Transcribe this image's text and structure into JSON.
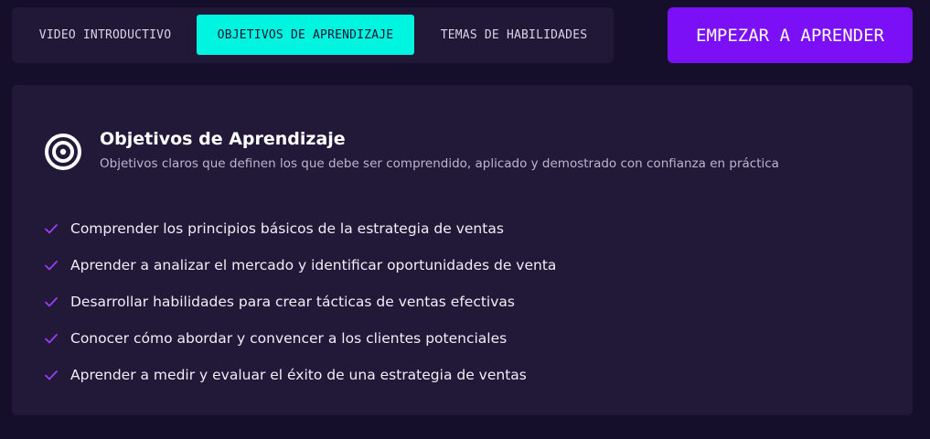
{
  "tabs": [
    {
      "label": "VIDEO INTRODUCTIVO",
      "active": false
    },
    {
      "label": "OBJETIVOS DE APRENDIZAJE",
      "active": true
    },
    {
      "label": "TEMAS DE HABILIDADES",
      "active": false
    }
  ],
  "cta": {
    "label": "EMPEZAR A APRENDER"
  },
  "panel": {
    "icon": "target-icon",
    "title": "Objetivos de Aprendizaje",
    "subtitle": "Objetivos claros que definen los que debe ser comprendido, aplicado y demostrado con confianza en práctica",
    "objectives": [
      "Comprender los principios básicos de la estrategia de ventas",
      "Aprender a analizar el mercado y identificar oportunidades de venta",
      "Desarrollar habilidades para crear tácticas de ventas efectivas",
      "Conocer cómo abordar y convencer a los clientes potenciales",
      "Aprender a medir y evaluar el éxito de una estrategia de ventas"
    ]
  },
  "colors": {
    "background": "#160f2b",
    "panel": "#221939",
    "tab_active": "#00f5e1",
    "cta": "#7b10f6",
    "check": "#9b3cf7"
  }
}
